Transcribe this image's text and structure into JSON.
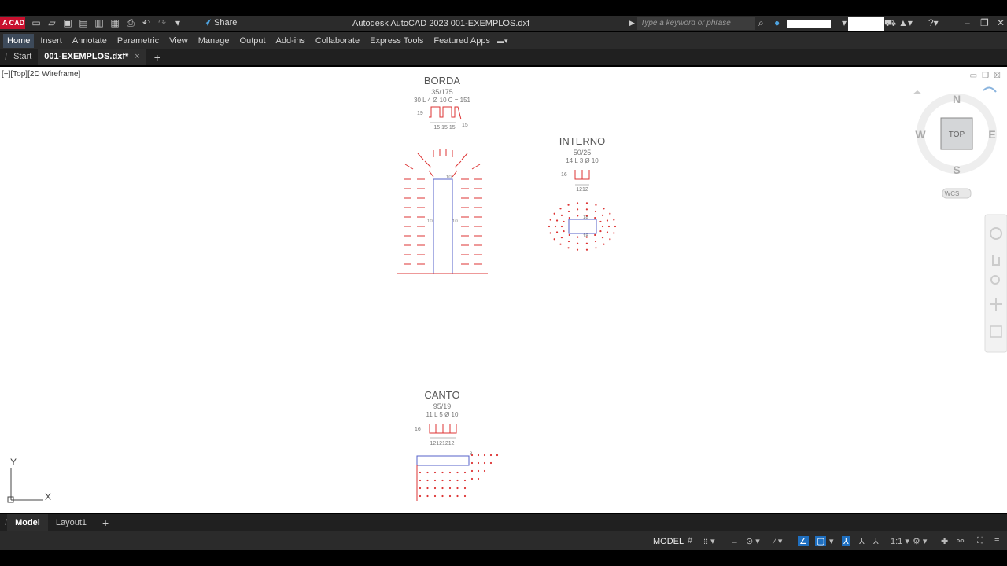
{
  "app": {
    "logo": "A CAD",
    "title": "Autodesk AutoCAD 2023    001-EXEMPLOS.dxf",
    "share_label": "Share",
    "search_placeholder": "Type a keyword or phrase"
  },
  "ribbon": {
    "tabs": [
      "Home",
      "Insert",
      "Annotate",
      "Parametric",
      "View",
      "Manage",
      "Output",
      "Add-ins",
      "Collaborate",
      "Express Tools",
      "Featured Apps"
    ],
    "active": "Home"
  },
  "file_tabs": {
    "start": "Start",
    "active_file": "001-EXEMPLOS.dxf*",
    "close": "×",
    "add": "+"
  },
  "viewport": {
    "label": "[−][Top][2D Wireframe]"
  },
  "drawing": {
    "borda": {
      "title": "BORDA",
      "ratio": "35/175",
      "spec": "30 L 4 Ø 10 C = 151",
      "dim_height": "19",
      "dim_bottom": "15  15  15",
      "dim_right": "15",
      "dim_top_inner": "10",
      "dim_left_inner": "10",
      "dim_right_inner": "10"
    },
    "interno": {
      "title": "INTERNO",
      "ratio": "50/25",
      "spec": "14 L 3 Ø 10",
      "dim_height": "16",
      "dim_bottom": "1212",
      "dim_top_inner": "18",
      "dim_bottom_inner": "18"
    },
    "canto": {
      "title": "CANTO",
      "ratio": "95/19",
      "spec": "11 L 5 Ø 10",
      "dim_height": "16",
      "dim_bottom": "12121212",
      "dim_side": "8"
    }
  },
  "viewcube": {
    "north": "N",
    "south": "S",
    "east": "E",
    "west": "W",
    "face": "TOP",
    "ucs": "WCS"
  },
  "ucs_icon": {
    "x": "X",
    "y": "Y"
  },
  "layout_tabs": {
    "model": "Model",
    "layout1": "Layout1",
    "add": "+"
  },
  "status_bar": {
    "model_label": "MODEL",
    "scale": "1:1"
  }
}
